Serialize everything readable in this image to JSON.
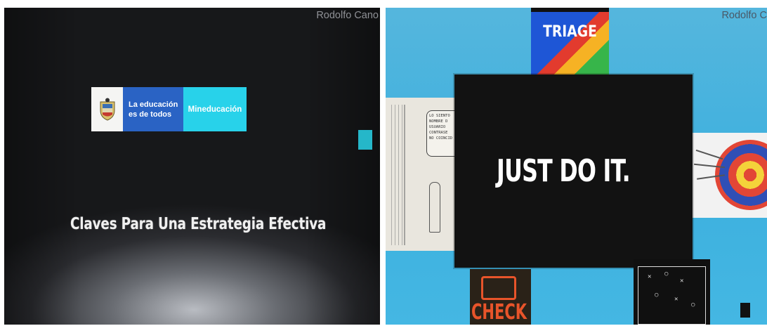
{
  "left_photo": {
    "author": "Rodolfo Cano",
    "logo": {
      "line1": "La educación",
      "line2": "es de todos",
      "brand": "Mineducación"
    },
    "title": "Claves Para Una Estrategia Efectiva",
    "colors": {
      "accent": "#25b7c9",
      "logo_blue": "#2a63c4",
      "logo_cyan": "#28d2ea"
    }
  },
  "right_photo": {
    "author": "Rodolfo Ca",
    "triage_label": "TRIAGE",
    "slogan": "JUST DO IT.",
    "check_label": "CHECK",
    "cartoon_text": [
      "LO SIENTO",
      "NOMBRE D",
      "USUARIO",
      "CONTRASE",
      "NO COINCID"
    ],
    "icons": [
      "comic-cartoon-icon",
      "dartboard-target-icon",
      "check-engine-icon",
      "tactics-board-icon"
    ],
    "colors": {
      "background": "#44b7e3",
      "card": "#121212"
    }
  }
}
